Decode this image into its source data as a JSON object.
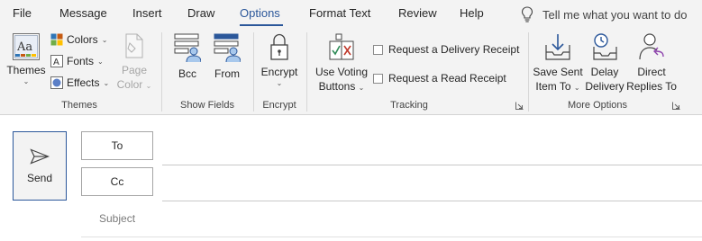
{
  "tabs": [
    {
      "label": "File",
      "active": false
    },
    {
      "label": "Message",
      "active": false
    },
    {
      "label": "Insert",
      "active": false
    },
    {
      "label": "Draw",
      "active": false
    },
    {
      "label": "Options",
      "active": true
    },
    {
      "label": "Format Text",
      "active": false
    },
    {
      "label": "Review",
      "active": false
    },
    {
      "label": "Help",
      "active": false
    }
  ],
  "tell_me": {
    "icon": "lightbulb-icon",
    "text": "Tell me what you want to do"
  },
  "ribbon": {
    "themes": {
      "themes_button": "Themes",
      "colors": "Colors",
      "fonts": "Fonts",
      "effects": "Effects",
      "page_color_line1": "Page",
      "page_color_line2": "Color",
      "group_label": "Themes"
    },
    "show_fields": {
      "bcc": "Bcc",
      "from": "From",
      "group_label": "Show Fields"
    },
    "encrypt": {
      "encrypt_button": "Encrypt",
      "group_label": "Encrypt"
    },
    "tracking": {
      "voting_line1": "Use Voting",
      "voting_line2": "Buttons",
      "delivery_receipt": "Request a Delivery Receipt",
      "read_receipt": "Request a Read Receipt",
      "group_label": "Tracking"
    },
    "more_options": {
      "save_sent_line1": "Save Sent",
      "save_sent_line2": "Item To",
      "delay_line1": "Delay",
      "delay_line2": "Delivery",
      "direct_line1": "Direct",
      "direct_line2": "Replies To",
      "group_label": "More Options"
    }
  },
  "compose": {
    "send_label": "Send",
    "to_label": "To",
    "cc_label": "Cc",
    "subject_label": "Subject"
  },
  "colors": {
    "accent": "#2b579a",
    "ribbon_bg": "#f3f3f3"
  }
}
